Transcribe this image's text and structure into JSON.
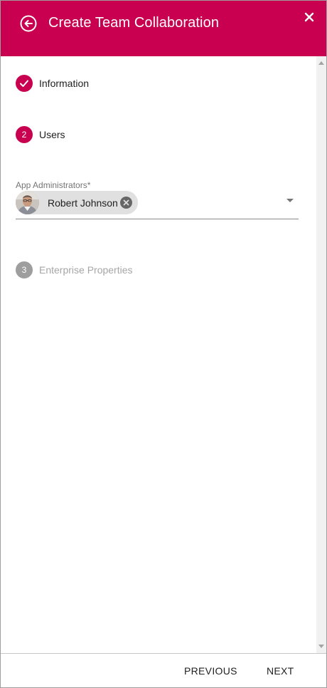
{
  "header": {
    "title": "Create Team Collaboration",
    "back_icon": "arrow-back-circle-icon",
    "close_icon": "close-icon",
    "color": "#c8004f"
  },
  "steps": [
    {
      "state": "completed",
      "marker": "",
      "label": "Information"
    },
    {
      "state": "active",
      "marker": "2",
      "label": "Users"
    },
    {
      "state": "disabled",
      "marker": "3",
      "label": "Enterprise Properties"
    }
  ],
  "users_form": {
    "field_label": "App Administrators*",
    "chips": [
      {
        "name": "Robert Johnson"
      }
    ]
  },
  "footer": {
    "previous_label": "PREVIOUS",
    "next_label": "NEXT"
  }
}
